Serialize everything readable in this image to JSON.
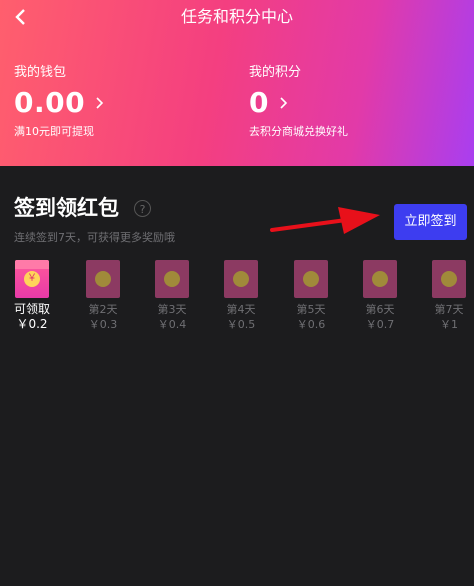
{
  "header": {
    "title": "任务和积分中心",
    "back_icon": "back-chevron-icon"
  },
  "wallet": {
    "label": "我的钱包",
    "amount": "0.00",
    "note": "满10元即可提现"
  },
  "points": {
    "label": "我的积分",
    "amount": "0",
    "note": "去积分商城兑换好礼"
  },
  "checkin": {
    "title": "签到领红包",
    "help_icon": "question-icon",
    "subtitle": "连续签到7天，可获得更多奖励哦",
    "button_label": "立即签到",
    "days": [
      {
        "label": "可领取",
        "value": "￥0.2",
        "state": "active",
        "coin": "￥"
      },
      {
        "label": "第2天",
        "value": "￥0.3",
        "state": "locked",
        "coin": ""
      },
      {
        "label": "第3天",
        "value": "￥0.4",
        "state": "locked",
        "coin": ""
      },
      {
        "label": "第4天",
        "value": "￥0.5",
        "state": "locked",
        "coin": ""
      },
      {
        "label": "第5天",
        "value": "￥0.6",
        "state": "locked",
        "coin": ""
      },
      {
        "label": "第6天",
        "value": "￥0.7",
        "state": "locked",
        "coin": ""
      },
      {
        "label": "第7天",
        "value": "￥1",
        "state": "locked",
        "coin": ""
      }
    ]
  },
  "colors": {
    "accent_button": "#3d3df0",
    "annotation_arrow": "#e8101a",
    "background": "#1c1c1e"
  }
}
